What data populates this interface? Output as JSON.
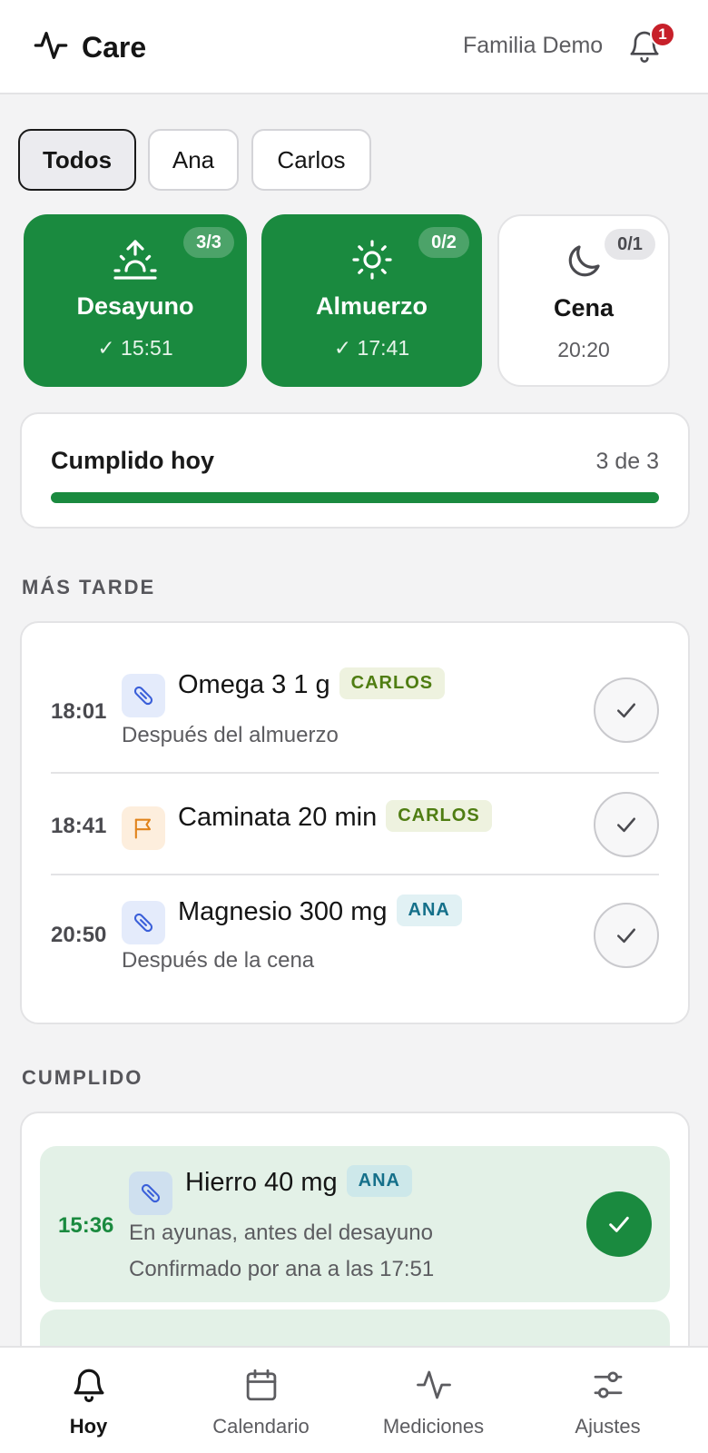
{
  "header": {
    "app_title": "Care",
    "family_name": "Familia Demo",
    "notification_count": "1"
  },
  "filters": [
    "Todos",
    "Ana",
    "Carlos"
  ],
  "meals": [
    {
      "name": "Desayuno",
      "time": "✓ 15:51",
      "count": "3/3",
      "icon": "sunrise-icon",
      "state": "done"
    },
    {
      "name": "Almuerzo",
      "time": "✓ 17:41",
      "count": "0/2",
      "icon": "sun-icon",
      "state": "done"
    },
    {
      "name": "Cena",
      "time": "20:20",
      "count": "0/1",
      "icon": "moon-icon",
      "state": "pending"
    }
  ],
  "progress": {
    "title": "Cumplido hoy",
    "count": "3 de 3",
    "fraction": 1.0
  },
  "later": {
    "heading": "MÁS TARDE",
    "items": [
      {
        "time": "18:01",
        "title": "Omega 3 1 g",
        "tag": "CARLOS",
        "subtitle": "Después del almuerzo",
        "icon": "pill-icon"
      },
      {
        "time": "18:41",
        "title": "Caminata 20 min",
        "tag": "CARLOS",
        "subtitle": "",
        "icon": "flag-icon"
      },
      {
        "time": "20:50",
        "title": "Magnesio 300 mg",
        "tag": "ANA",
        "subtitle": "Después de la cena",
        "icon": "pill-icon"
      }
    ]
  },
  "done": {
    "heading": "CUMPLIDO",
    "items": [
      {
        "time": "15:36",
        "title": "Hierro 40 mg",
        "tag": "ANA",
        "subtitle": "En ayunas, antes del desayuno",
        "confirmation": "Confirmado por ana a las 17:51",
        "icon": "pill-icon"
      }
    ]
  },
  "nav": [
    {
      "label": "Hoy",
      "icon": "bell-icon",
      "active": true
    },
    {
      "label": "Calendario",
      "icon": "calendar-icon",
      "active": false
    },
    {
      "label": "Mediciones",
      "icon": "activity-icon",
      "active": false
    },
    {
      "label": "Ajustes",
      "icon": "sliders-icon",
      "active": false
    }
  ],
  "colors": {
    "accent_green": "#1a8a3f",
    "tag_carlos": "#4f7d12",
    "tag_ana": "#15708a",
    "badge_red": "#c7202a"
  }
}
